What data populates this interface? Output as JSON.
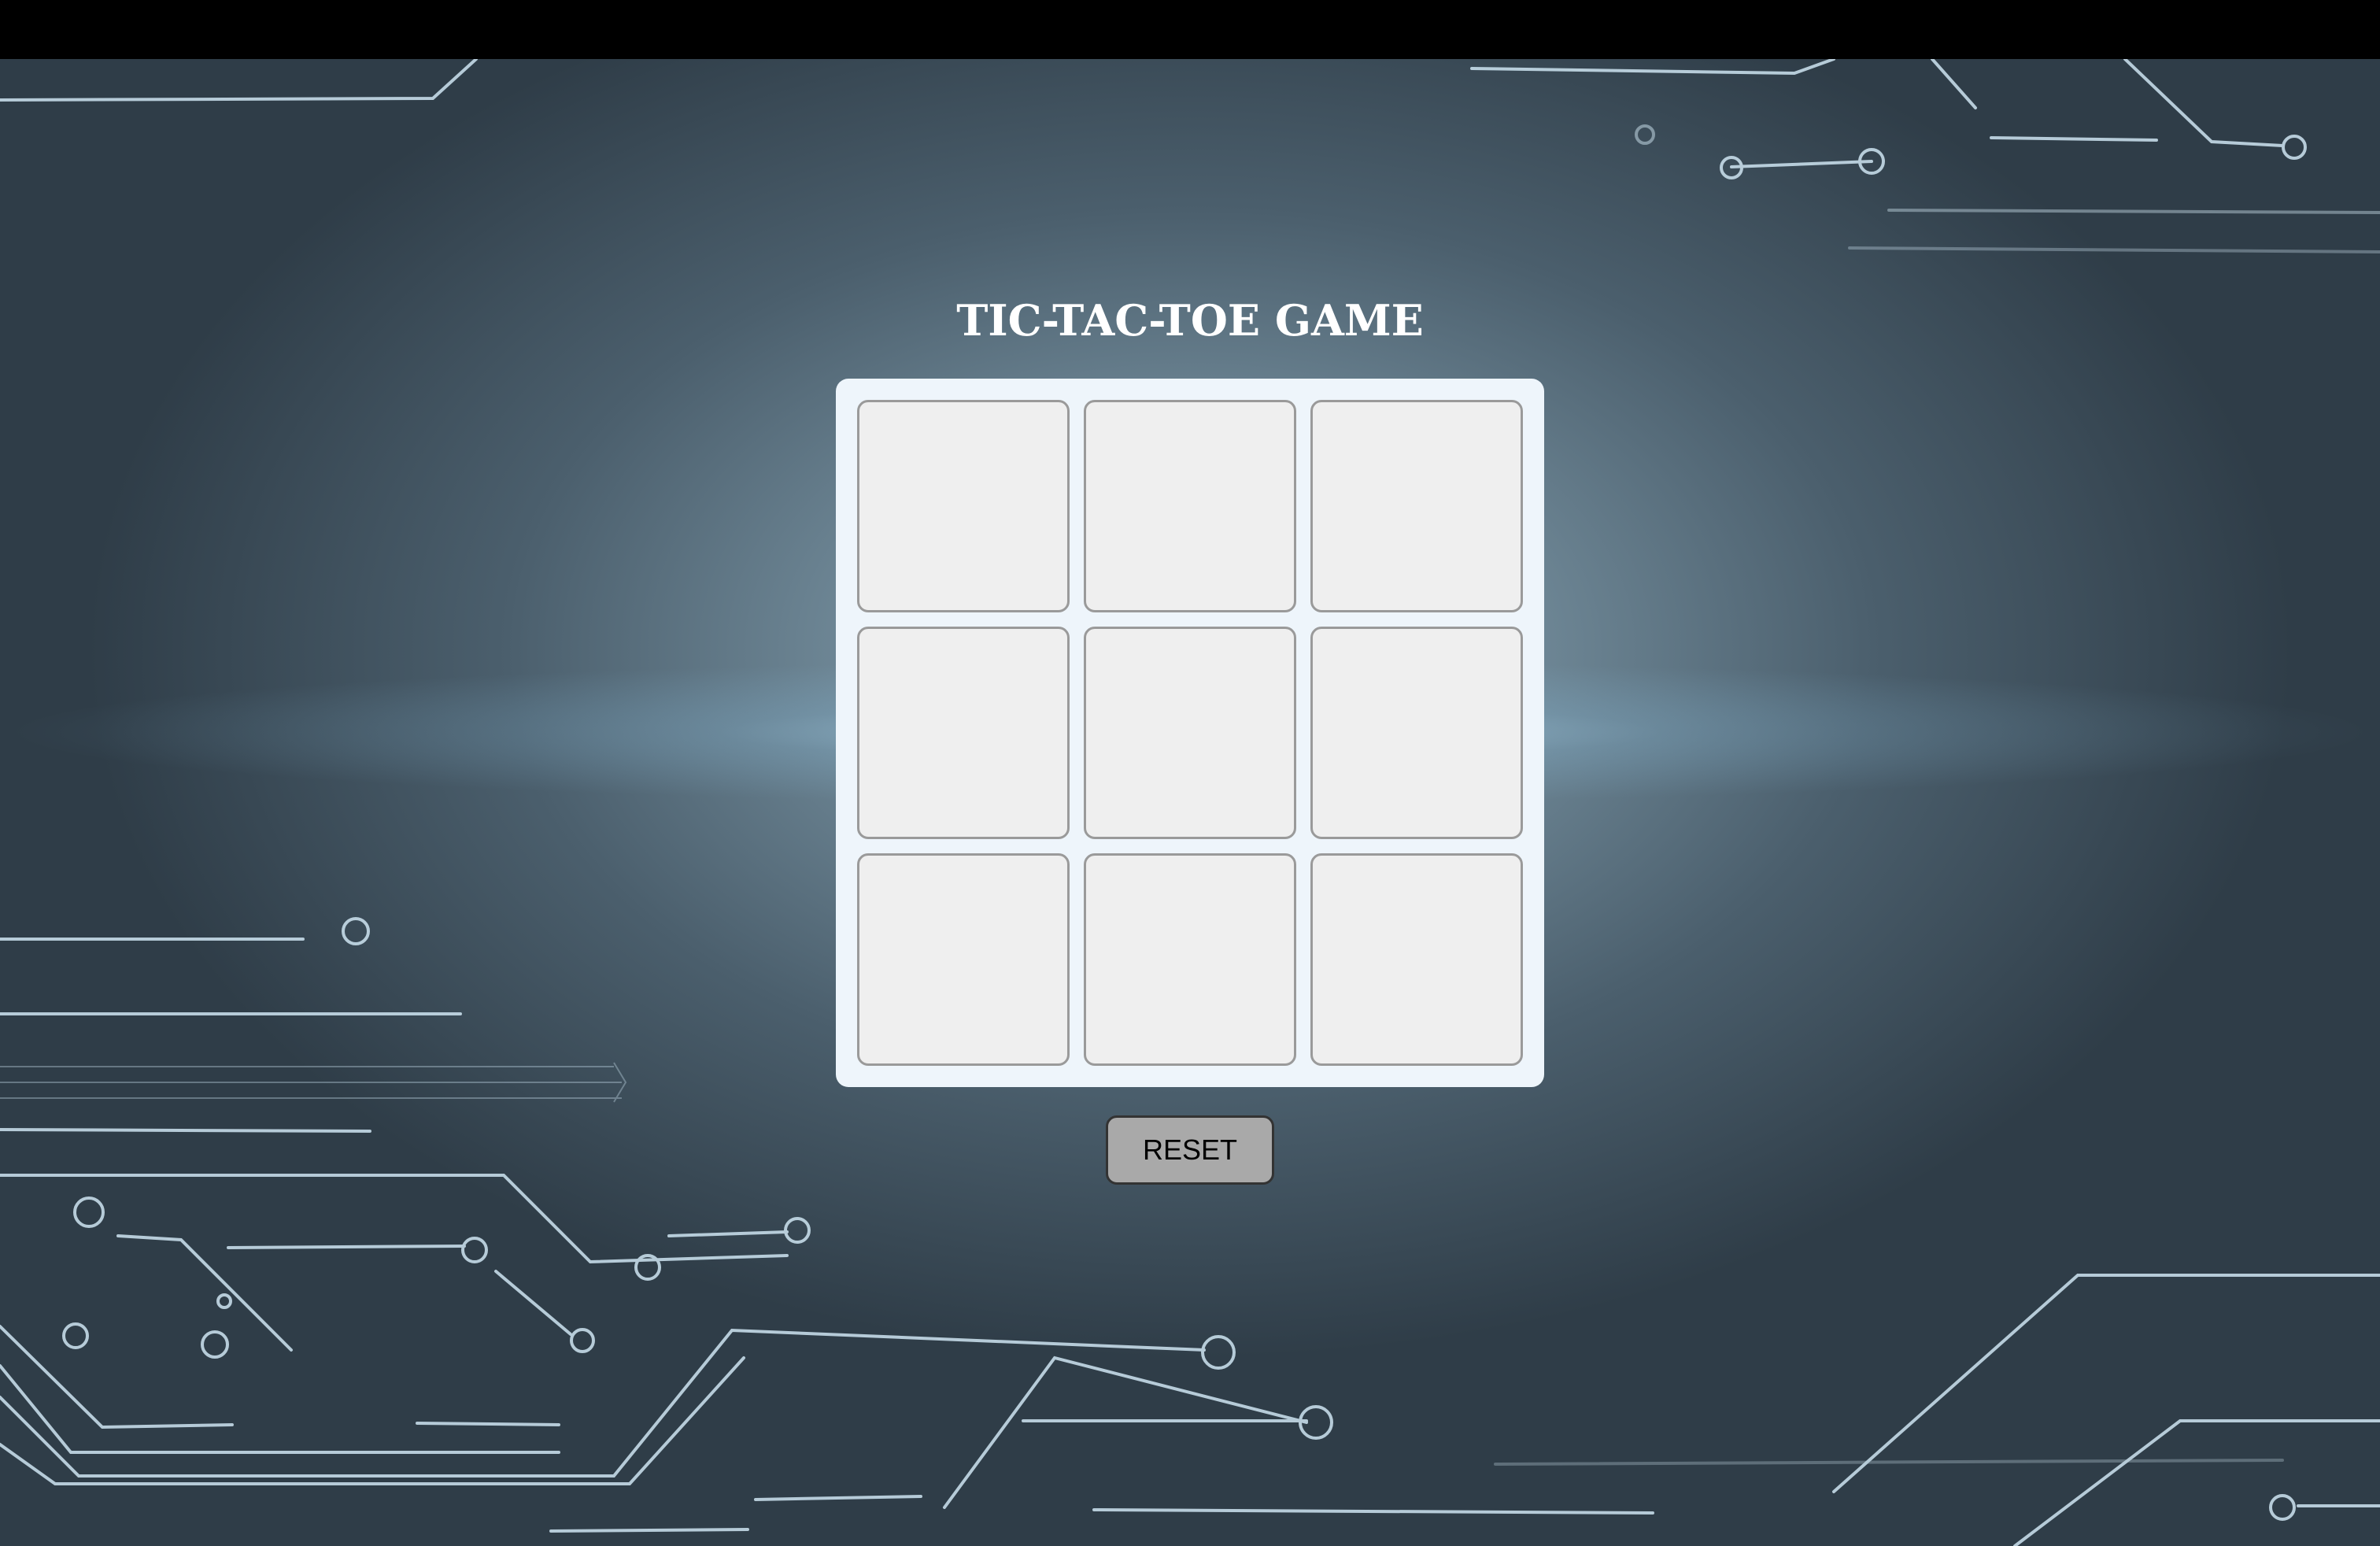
{
  "game": {
    "title": "TIC-TAC-TOE GAME",
    "cells": [
      "",
      "",
      "",
      "",
      "",
      "",
      "",
      "",
      ""
    ],
    "reset_label": "RESET"
  },
  "colors": {
    "board_background": "#eef5fb",
    "cell_background": "#efefef",
    "cell_border": "#9a9a9a",
    "button_background": "#a9a9a9",
    "title_text": "#ffffff",
    "circuit_line": "#cfe6f2"
  }
}
